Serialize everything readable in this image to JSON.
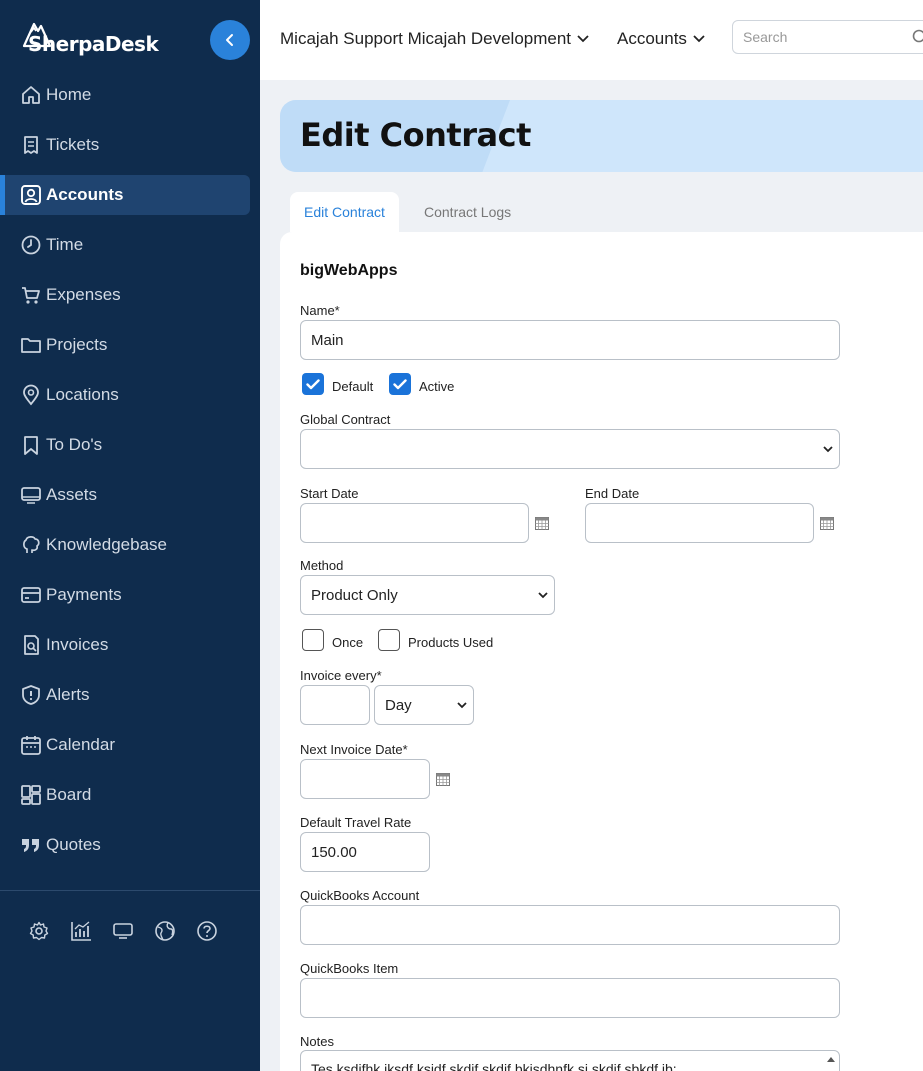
{
  "brand": {
    "name": "SherpaDesk"
  },
  "sidebar": {
    "items": [
      {
        "label": "Home",
        "icon": "home-icon"
      },
      {
        "label": "Tickets",
        "icon": "ticket-icon"
      },
      {
        "label": "Accounts",
        "icon": "account-icon",
        "active": true
      },
      {
        "label": "Time",
        "icon": "clock-icon"
      },
      {
        "label": "Expenses",
        "icon": "cart-icon"
      },
      {
        "label": "Projects",
        "icon": "folder-icon"
      },
      {
        "label": "Locations",
        "icon": "map-pin-icon"
      },
      {
        "label": "To Do's",
        "icon": "bookmark-icon"
      },
      {
        "label": "Assets",
        "icon": "monitor-icon"
      },
      {
        "label": "Knowledgebase",
        "icon": "brain-icon"
      },
      {
        "label": "Payments",
        "icon": "credit-card-icon"
      },
      {
        "label": "Invoices",
        "icon": "invoice-icon"
      },
      {
        "label": "Alerts",
        "icon": "alert-icon"
      },
      {
        "label": "Calendar",
        "icon": "calendar-icon"
      },
      {
        "label": "Board",
        "icon": "board-icon"
      },
      {
        "label": "Quotes",
        "icon": "quote-icon"
      }
    ],
    "tools": [
      "settings-icon",
      "reports-icon",
      "display-icon",
      "globe-icon",
      "help-icon"
    ]
  },
  "topbar": {
    "org": "Micajah Support Micajah Development",
    "accounts": "Accounts",
    "search_placeholder": "Search"
  },
  "page": {
    "title": "Edit Contract"
  },
  "tabs": [
    {
      "label": "Edit Contract",
      "active": true
    },
    {
      "label": "Contract Logs",
      "active": false
    }
  ],
  "form": {
    "account_name": "bigWebApps",
    "name_label": "Name*",
    "name_value": "Main",
    "default_label": "Default",
    "default_checked": true,
    "active_label": "Active",
    "active_checked": true,
    "global_contract_label": "Global Contract",
    "global_contract_value": "",
    "start_date_label": "Start Date",
    "start_date_value": "",
    "end_date_label": "End Date",
    "end_date_value": "",
    "method_label": "Method",
    "method_value": "Product Only",
    "once_label": "Once",
    "once_checked": false,
    "products_used_label": "Products Used",
    "products_used_checked": false,
    "invoice_every_label": "Invoice every*",
    "invoice_every_value": "",
    "invoice_every_unit": "Day",
    "next_invoice_label": "Next Invoice Date*",
    "next_invoice_value": "",
    "travel_rate_label": "Default Travel Rate",
    "travel_rate_value": "150.00",
    "qb_account_label": "QuickBooks Account",
    "qb_account_value": "",
    "qb_item_label": "QuickBooks Item",
    "qb_item_value": "",
    "notes_label": "Notes",
    "notes_value": "Tes ksdifhk iksdf ksidf skdif skdif bkisdhnfk si skdif sbkdf ib:"
  },
  "colors": {
    "sidebar": "#0f2c4d",
    "accent": "#2a82da",
    "banner": "#cfe6fb"
  }
}
